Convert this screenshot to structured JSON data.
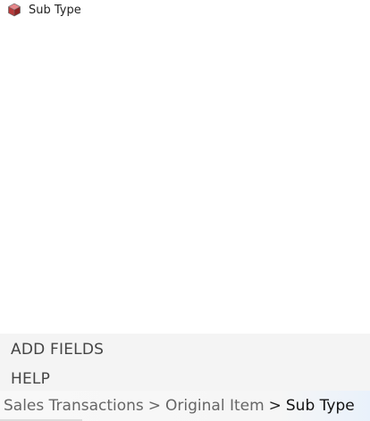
{
  "fields": {
    "items": [
      {
        "label": "Sub Type",
        "icon": "cube-icon",
        "icon_color": "#c0392b"
      }
    ]
  },
  "actions": {
    "add_fields_label": "ADD FIELDS",
    "help_label": "HELP"
  },
  "breadcrumb": {
    "items": [
      "Sales Transactions",
      "Original Item"
    ],
    "separator": ">",
    "current": "Sub Type"
  }
}
